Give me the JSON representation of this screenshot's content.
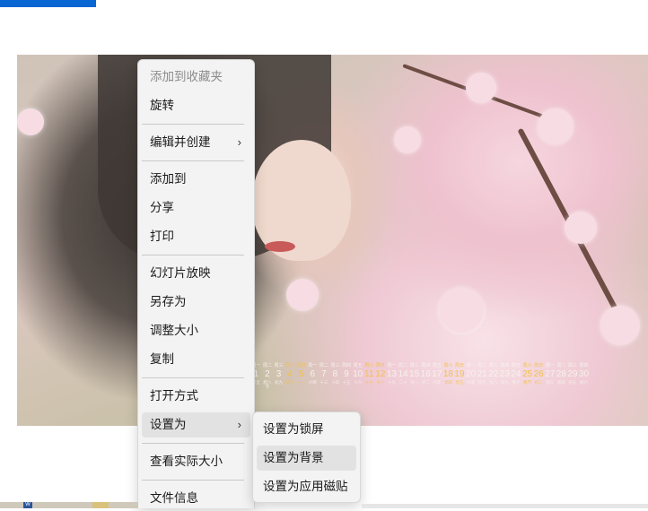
{
  "accent_color": "#0a66d2",
  "context_menu": {
    "items": [
      {
        "label": "添加到收藏夹",
        "disabled": true
      },
      {
        "label": "旋转"
      },
      {
        "label": "编辑并创建",
        "has_submenu": true
      },
      {
        "label": "添加到"
      },
      {
        "label": "分享"
      },
      {
        "label": "打印"
      },
      {
        "label": "幻灯片放映"
      },
      {
        "label": "另存为"
      },
      {
        "label": "调整大小"
      },
      {
        "label": "复制"
      },
      {
        "label": "打开方式"
      },
      {
        "label": "设置为",
        "has_submenu": true,
        "highlighted": true
      },
      {
        "label": "查看实际大小"
      },
      {
        "label": "文件信息"
      }
    ],
    "chevron": "›"
  },
  "submenu": {
    "items": [
      {
        "label": "设置为锁屏"
      },
      {
        "label": "设置为背景",
        "highlighted": true
      },
      {
        "label": "设置为应用磁贴"
      }
    ]
  },
  "calendar": {
    "days": [
      {
        "wk": "周一",
        "num": "1",
        "sub": "元旦"
      },
      {
        "wk": "周二",
        "num": "2",
        "sub": "腊八节"
      },
      {
        "wk": "周三",
        "num": "3",
        "sub": "初九"
      },
      {
        "wk": "周六",
        "num": "4",
        "sub": "初十",
        "weekend": true
      },
      {
        "wk": "周日",
        "num": "5",
        "sub": "十一",
        "weekend": true
      },
      {
        "wk": "周一",
        "num": "6",
        "sub": "小寒"
      },
      {
        "wk": "周二",
        "num": "7",
        "sub": "十三"
      },
      {
        "wk": "周三",
        "num": "8",
        "sub": "十四"
      },
      {
        "wk": "周四",
        "num": "9",
        "sub": "十五"
      },
      {
        "wk": "周五",
        "num": "10",
        "sub": "十六"
      },
      {
        "wk": "周六",
        "num": "11",
        "sub": "十七",
        "weekend": true
      },
      {
        "wk": "周日",
        "num": "12",
        "sub": "十八",
        "weekend": true
      },
      {
        "wk": "周一",
        "num": "13",
        "sub": "十九"
      },
      {
        "wk": "周二",
        "num": "14",
        "sub": "二十"
      },
      {
        "wk": "周三",
        "num": "15",
        "sub": "廿一"
      },
      {
        "wk": "周四",
        "num": "16",
        "sub": "廿二"
      },
      {
        "wk": "周五",
        "num": "17",
        "sub": "小年"
      },
      {
        "wk": "周六",
        "num": "18",
        "sub": "廿四",
        "weekend": true
      },
      {
        "wk": "周日",
        "num": "19",
        "sub": "廿五",
        "weekend": true
      },
      {
        "wk": "周一",
        "num": "20",
        "sub": "大寒"
      },
      {
        "wk": "周二",
        "num": "21",
        "sub": "廿七"
      },
      {
        "wk": "周三",
        "num": "22",
        "sub": "廿八"
      },
      {
        "wk": "周四",
        "num": "23",
        "sub": "廿九"
      },
      {
        "wk": "周五",
        "num": "24",
        "sub": "除夕"
      },
      {
        "wk": "周六",
        "num": "25",
        "sub": "春节",
        "weekend": true
      },
      {
        "wk": "周日",
        "num": "26",
        "sub": "初二",
        "weekend": true
      },
      {
        "wk": "周一",
        "num": "27",
        "sub": "初三"
      },
      {
        "wk": "周二",
        "num": "28",
        "sub": "初四"
      },
      {
        "wk": "周三",
        "num": "29",
        "sub": "初五"
      },
      {
        "wk": "周四",
        "num": "30",
        "sub": "初六"
      }
    ]
  },
  "taskbar": {
    "word_icon_letter": "W"
  }
}
